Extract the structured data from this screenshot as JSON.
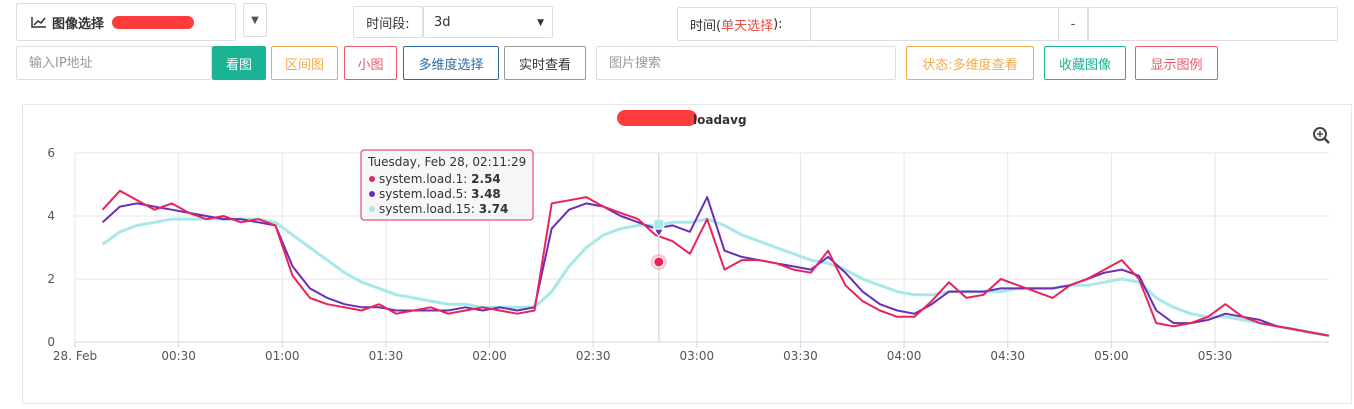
{
  "toolbar": {
    "image_select_label": "图像选择",
    "image_select_caret": "▼",
    "period_label": "时间段:",
    "period_value": "3d",
    "period_caret": "▼",
    "time_label_prefix": "时间(",
    "time_label_highlight": "单天选择",
    "time_label_suffix": "):",
    "time_separator": "-",
    "ip_placeholder": "输入IP地址",
    "view_button": "看图",
    "range_button": "区间图",
    "small_button": "小图",
    "multi_dim_button": "多维度选择",
    "realtime_button": "实时查看",
    "image_search_placeholder": "图片搜索",
    "status_multi_button": "状态:多维度查看",
    "favorite_button": "收藏图像",
    "legend_button": "显示图例"
  },
  "colors": {
    "teal": "#1ab394",
    "orange": "#f0ad4e",
    "red": "#e8566f",
    "blue": "#2e6da4",
    "series_load1": "#e8245a",
    "series_load5": "#6a2eb8",
    "series_load15": "#a8e8e8"
  },
  "icons": {
    "chart": "line-chart-icon",
    "zoom": "zoom-in-icon"
  },
  "chart_data": {
    "type": "line",
    "title": "loadavg",
    "ylim": [
      0,
      6
    ],
    "yticks": [
      "0",
      "2",
      "4",
      "6"
    ],
    "xtick_labels": [
      "28. Feb",
      "00:30",
      "01:00",
      "01:30",
      "02:00",
      "02:30",
      "03:00",
      "03:30",
      "04:00",
      "04:30",
      "05:00",
      "05:30"
    ],
    "x_minutes": [
      0,
      5,
      10,
      15,
      20,
      25,
      30,
      35,
      40,
      45,
      50,
      55,
      60,
      65,
      70,
      75,
      80,
      85,
      90,
      95,
      100,
      105,
      110,
      115,
      120,
      125,
      130,
      135,
      140,
      145,
      150,
      155,
      160,
      165,
      170,
      175,
      180,
      185,
      190,
      195,
      200,
      205,
      210,
      215,
      220,
      225,
      230,
      235,
      240,
      245,
      250,
      255,
      260,
      265,
      270,
      275,
      280,
      285,
      290,
      295,
      300,
      305,
      310,
      315,
      320,
      325,
      330,
      335,
      340,
      345,
      350,
      355
    ],
    "series": [
      {
        "name": "system.load.1",
        "values": [
          4.2,
          4.8,
          4.5,
          4.2,
          4.4,
          4.1,
          3.9,
          4.0,
          3.8,
          3.9,
          3.7,
          2.1,
          1.4,
          1.2,
          1.1,
          1.0,
          1.2,
          0.9,
          1.0,
          1.1,
          0.9,
          1.0,
          1.1,
          1.0,
          0.9,
          1.0,
          4.4,
          4.5,
          4.6,
          4.3,
          4.1,
          3.9,
          3.4,
          3.2,
          2.8,
          3.9,
          2.3,
          2.6,
          2.6,
          2.5,
          2.3,
          2.2,
          2.9,
          1.8,
          1.3,
          1.0,
          0.8,
          0.8,
          1.3,
          1.9,
          1.4,
          1.5,
          2.0,
          1.8,
          1.6,
          1.4,
          1.8,
          2.0,
          2.3,
          2.6,
          2.0,
          0.6,
          0.5,
          0.6,
          0.8,
          1.2,
          0.8,
          0.6,
          0.5,
          0.4,
          0.3,
          0.2
        ]
      },
      {
        "name": "system.load.5",
        "values": [
          3.8,
          4.3,
          4.4,
          4.3,
          4.2,
          4.1,
          4.0,
          3.9,
          3.9,
          3.8,
          3.7,
          2.4,
          1.7,
          1.4,
          1.2,
          1.1,
          1.1,
          1.0,
          1.0,
          1.0,
          1.0,
          1.1,
          1.0,
          1.1,
          1.0,
          1.1,
          3.6,
          4.2,
          4.4,
          4.3,
          4.0,
          3.8,
          3.6,
          3.7,
          3.5,
          4.6,
          2.9,
          2.7,
          2.6,
          2.5,
          2.4,
          2.3,
          2.7,
          2.2,
          1.6,
          1.2,
          1.0,
          0.9,
          1.2,
          1.6,
          1.6,
          1.6,
          1.7,
          1.7,
          1.7,
          1.7,
          1.8,
          2.0,
          2.2,
          2.3,
          2.1,
          1.0,
          0.6,
          0.6,
          0.7,
          0.9,
          0.8,
          0.7,
          0.5,
          0.4,
          0.3,
          0.2
        ]
      },
      {
        "name": "system.load.15",
        "values": [
          3.1,
          3.5,
          3.7,
          3.8,
          3.9,
          3.9,
          3.9,
          3.9,
          3.9,
          3.9,
          3.8,
          3.4,
          3.0,
          2.6,
          2.2,
          1.9,
          1.7,
          1.5,
          1.4,
          1.3,
          1.2,
          1.2,
          1.1,
          1.1,
          1.1,
          1.1,
          1.6,
          2.4,
          3.0,
          3.4,
          3.6,
          3.7,
          3.7,
          3.8,
          3.8,
          3.9,
          3.7,
          3.4,
          3.2,
          3.0,
          2.8,
          2.6,
          2.5,
          2.3,
          2.0,
          1.8,
          1.6,
          1.5,
          1.5,
          1.6,
          1.6,
          1.6,
          1.6,
          1.7,
          1.7,
          1.7,
          1.8,
          1.8,
          1.9,
          2.0,
          1.9,
          1.4,
          1.1,
          0.9,
          0.8,
          0.8,
          0.7,
          0.6,
          0.5,
          0.4,
          0.3,
          0.2
        ]
      }
    ],
    "tooltip": {
      "header": "Tuesday, Feb 28, 02:11:29",
      "rows": [
        {
          "name": "system.load.1",
          "value": "2.54"
        },
        {
          "name": "system.load.5",
          "value": "3.48"
        },
        {
          "name": "system.load.15",
          "value": "3.74"
        }
      ],
      "x_minute": 161
    }
  }
}
